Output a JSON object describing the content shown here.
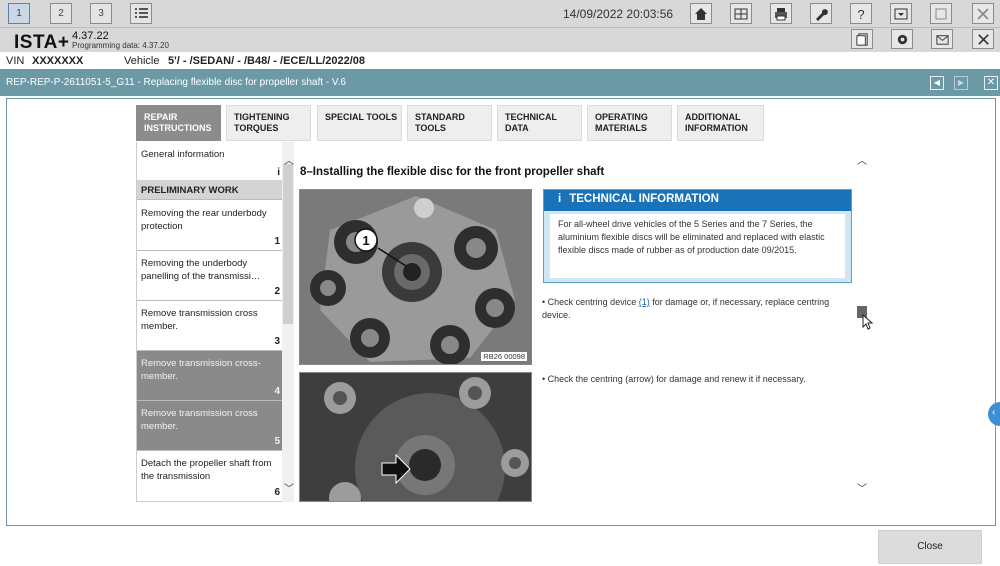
{
  "topbar": {
    "tabs": [
      "1",
      "2",
      "3"
    ],
    "datetime": "14/09/2022 20:03:56",
    "buttons": [
      "home-icon",
      "info-table-icon",
      "print-icon",
      "wrench-icon",
      "help-icon",
      "dropdown-icon",
      "window-icon",
      "close-icon"
    ]
  },
  "header": {
    "brand": "ISTA+",
    "version": "4.37.22",
    "programming_label": "Programming data:",
    "programming_version": "4.37.20",
    "buttons": [
      "document-icon",
      "settings-icon",
      "mail-icon",
      "close-icon"
    ]
  },
  "vehicle": {
    "vin_label": "VIN",
    "vin_value": "XXXXXXX",
    "vehicle_label": "Vehicle",
    "vehicle_value": "5'/ - /SEDAN/ - /B48/ - /ECE/LL/2022/08"
  },
  "document": {
    "title": "REP-REP-P-2611051-5_G11 - Replacing flexible disc for propeller shaft - V.6"
  },
  "tabs": [
    {
      "line1": "REPAIR",
      "line2": "INSTRUCTIONS"
    },
    {
      "line1": "TIGHTENING",
      "line2": "TORQUES"
    },
    {
      "line1": "SPECIAL TOOLS",
      "line2": ""
    },
    {
      "line1": "STANDARD",
      "line2": "TOOLS"
    },
    {
      "line1": "TECHNICAL",
      "line2": "DATA"
    },
    {
      "line1": "OPERATING",
      "line2": "MATERIALS"
    },
    {
      "line1": "ADDITIONAL",
      "line2": "INFORMATION"
    }
  ],
  "sidebar": {
    "items": [
      {
        "label": "General information",
        "num": "i"
      },
      {
        "label": "PRELIMINARY WORK",
        "num": ""
      },
      {
        "label": "Removing the rear underbody protection",
        "num": "1"
      },
      {
        "label": "Removing the underbody panelling of the transmissi…",
        "num": "2"
      },
      {
        "label": "Remove transmission cross member.",
        "num": "3"
      },
      {
        "label": "Remove transmission cross-member.",
        "num": "4"
      },
      {
        "label": "Remove transmission cross member.",
        "num": "5"
      },
      {
        "label": "Detach the propeller shaft from the transmission",
        "num": "6"
      }
    ]
  },
  "content": {
    "heading": "8–Installing the flexible disc for the front propeller shaft",
    "image1_caption": "RB26 00098",
    "image1_callout": "1",
    "tech_info": {
      "icon": "i",
      "title": "TECHNICAL INFORMATION",
      "body": "For all-wheel drive vehicles of the 5 Series and the 7 Series, the aluminium flexible discs will be eliminated and replaced with elastic flexible discs made of rubber as of production date 09/2015."
    },
    "bullet1_pre": "Check centring device",
    "bullet1_link": "(1)",
    "bullet1_post": "for damage or, if necessary, replace centring device.",
    "bullet2": "Check the centring (arrow) for damage and renew it if necessary."
  },
  "footer": {
    "close_label": "Close"
  }
}
